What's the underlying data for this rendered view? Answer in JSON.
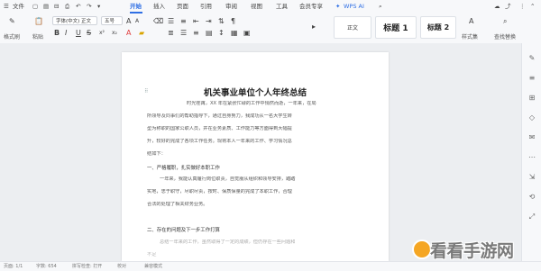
{
  "menubar": {
    "file": "文件",
    "tabs": [
      "开始",
      "插入",
      "页面",
      "引用",
      "审阅",
      "视图",
      "工具",
      "会员专享"
    ],
    "active_tab": "开始",
    "wps_ai": "WPS AI"
  },
  "ribbon": {
    "format_painter": "格式刷",
    "paste": "粘贴",
    "font_name": "字体(中文) 正文",
    "font_size": "五号",
    "style_normal": "正文",
    "style_h1": "标题 1",
    "style_h2": "标题 2",
    "styles": "样式集",
    "find_replace": "查找替换"
  },
  "document": {
    "title": "机关事业单位个人年终总结",
    "lines": [
      "时光荏苒，XX 年在紧张忙碌的工作中悄然而逝，一年来，在局",
      "所领导及同事们的帮助指导下，通过自身努力，我成功从一名大学生转",
      "型为称职的国家公职人员，并在业务素质、工作能力等方面得到大幅提",
      "升，较好的完成了各项工作任务。现将本人一年来的工作、学习情况总",
      "结如下："
    ],
    "heading1": "一、严格履职，扎实做好本职工作",
    "lines2": [
      "一年来，我能认真履行岗位职责，自觉服从组织和领导安排，踏踏",
      "实地，忠于职守，尽职尽责，按时、保质保量的完成了本职工作，合理",
      "合法的处理了相关财务业务。"
    ],
    "heading2": "二、存在的问题及下一步工作打算",
    "lines3": [
      "总结一年来的工作，虽然取得了一定的成绩，但仍存在一些问题和",
      "不足"
    ]
  },
  "statusbar": {
    "page": "页面: 1/1",
    "words": "字数: 654",
    "spell": "拼写检查: 打开",
    "proof": "校对",
    "compat": "兼容模式"
  },
  "watermark": {
    "text": "看看手游网"
  }
}
